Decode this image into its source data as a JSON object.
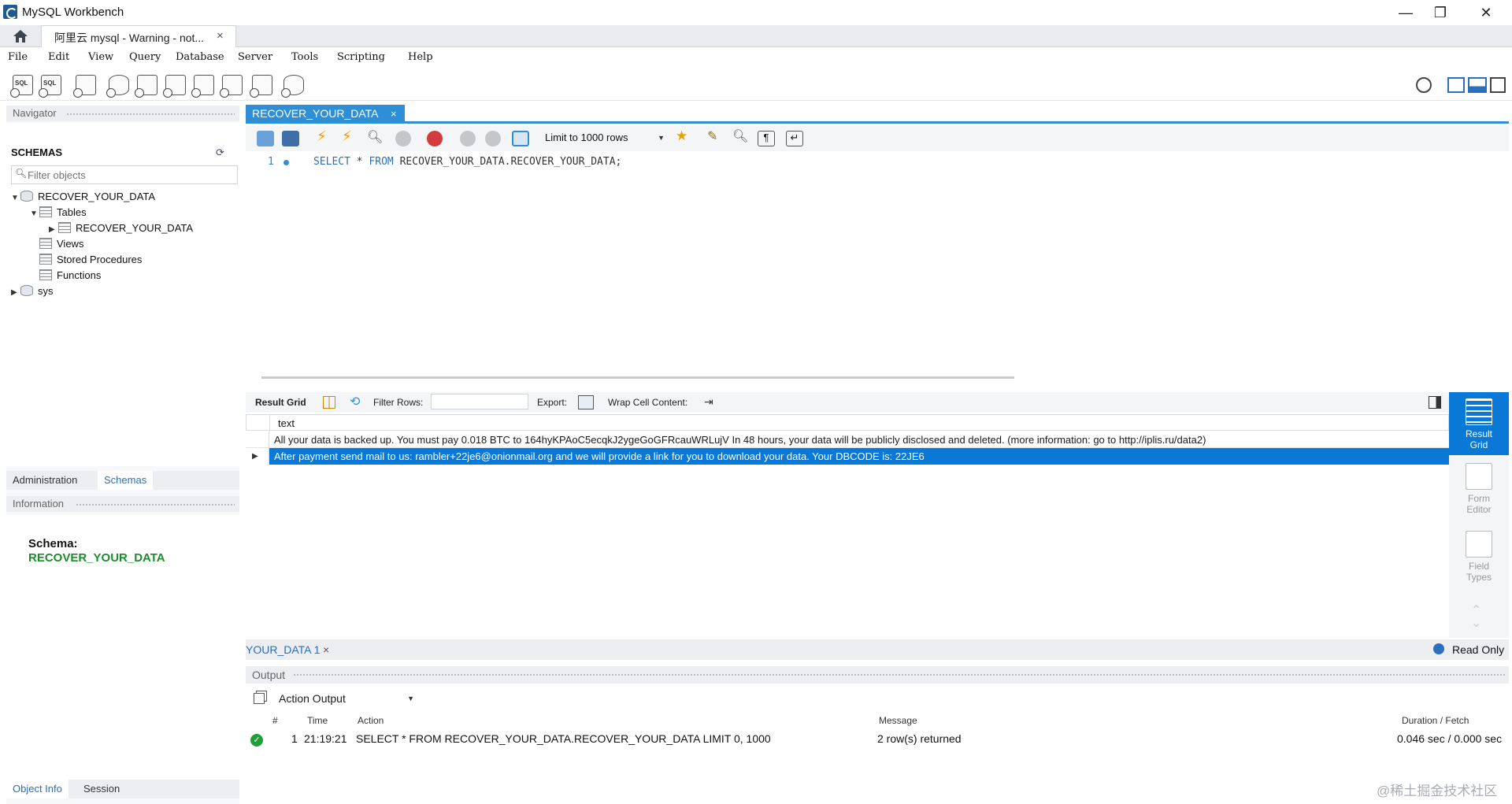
{
  "window": {
    "title": "MySQL Workbench",
    "minimize": "—",
    "restore": "❐",
    "close": "✕"
  },
  "connection_tab": {
    "label": "阿里云 mysql - Warning - not...",
    "close": "×"
  },
  "menu": [
    "File",
    "Edit",
    "View",
    "Query",
    "Database",
    "Server",
    "Tools",
    "Scripting",
    "Help"
  ],
  "navigator": {
    "header": "Navigator",
    "schemas_label": "SCHEMAS",
    "filter_placeholder": "Filter objects",
    "tree": {
      "schema": "RECOVER_YOUR_DATA",
      "tables": "Tables",
      "table": "RECOVER_YOUR_DATA",
      "views": "Views",
      "stored_procedures": "Stored Procedures",
      "functions": "Functions",
      "sys": "sys"
    },
    "tabs": [
      "Administration",
      "Schemas"
    ]
  },
  "information": {
    "header": "Information",
    "schema_label": "Schema:",
    "schema_value": "RECOVER_YOUR_DATA",
    "tabs": [
      "Object Info",
      "Session"
    ]
  },
  "editor": {
    "tab_label": "RECOVER_YOUR_DATA",
    "tab_close": "×",
    "limit": "Limit to 1000 rows",
    "line_number": "1",
    "sql": {
      "select": "SELECT",
      "star": " * ",
      "from": "FROM",
      "rest": " RECOVER_YOUR_DATA.RECOVER_YOUR_DATA;"
    }
  },
  "result": {
    "grid_label": "Result Grid",
    "filter_rows": "Filter Rows:",
    "export": "Export:",
    "wrap": "Wrap Cell Content:",
    "column": "text",
    "rows": [
      "All your data is backed up. You must pay 0.018 BTC to 164hyKPAoC5ecqkJ2ygeGoGFRcauWRLujV In 48 hours, your data will be publicly disclosed and deleted. (more information: go to http://iplis.ru/data2)",
      "After payment send mail to us: rambler+22je6@onionmail.org and we will provide a link for you to download your data. Your DBCODE is: 22JE6"
    ],
    "side": {
      "result_grid": [
        "Result",
        "Grid"
      ],
      "form_editor": [
        "Form",
        "Editor"
      ],
      "field_types": [
        "Field",
        "Types"
      ]
    },
    "status_tab": "YOUR_DATA 1",
    "status_tab_close": "×",
    "read_only": "Read Only"
  },
  "output": {
    "header": "Output",
    "select": "Action Output",
    "columns": [
      "#",
      "Time",
      "Action",
      "Message",
      "Duration / Fetch"
    ],
    "row": {
      "num": "1",
      "time": "21:19:21",
      "action": "SELECT * FROM RECOVER_YOUR_DATA.RECOVER_YOUR_DATA LIMIT 0, 1000",
      "message": "2 row(s) returned",
      "duration": "0.046 sec / 0.000 sec"
    }
  },
  "watermark": "@稀土掘金技术社区",
  "colors": {
    "accent": "#2e8fd6",
    "selection": "#0a78d7",
    "schema_green": "#1c8c2c"
  }
}
